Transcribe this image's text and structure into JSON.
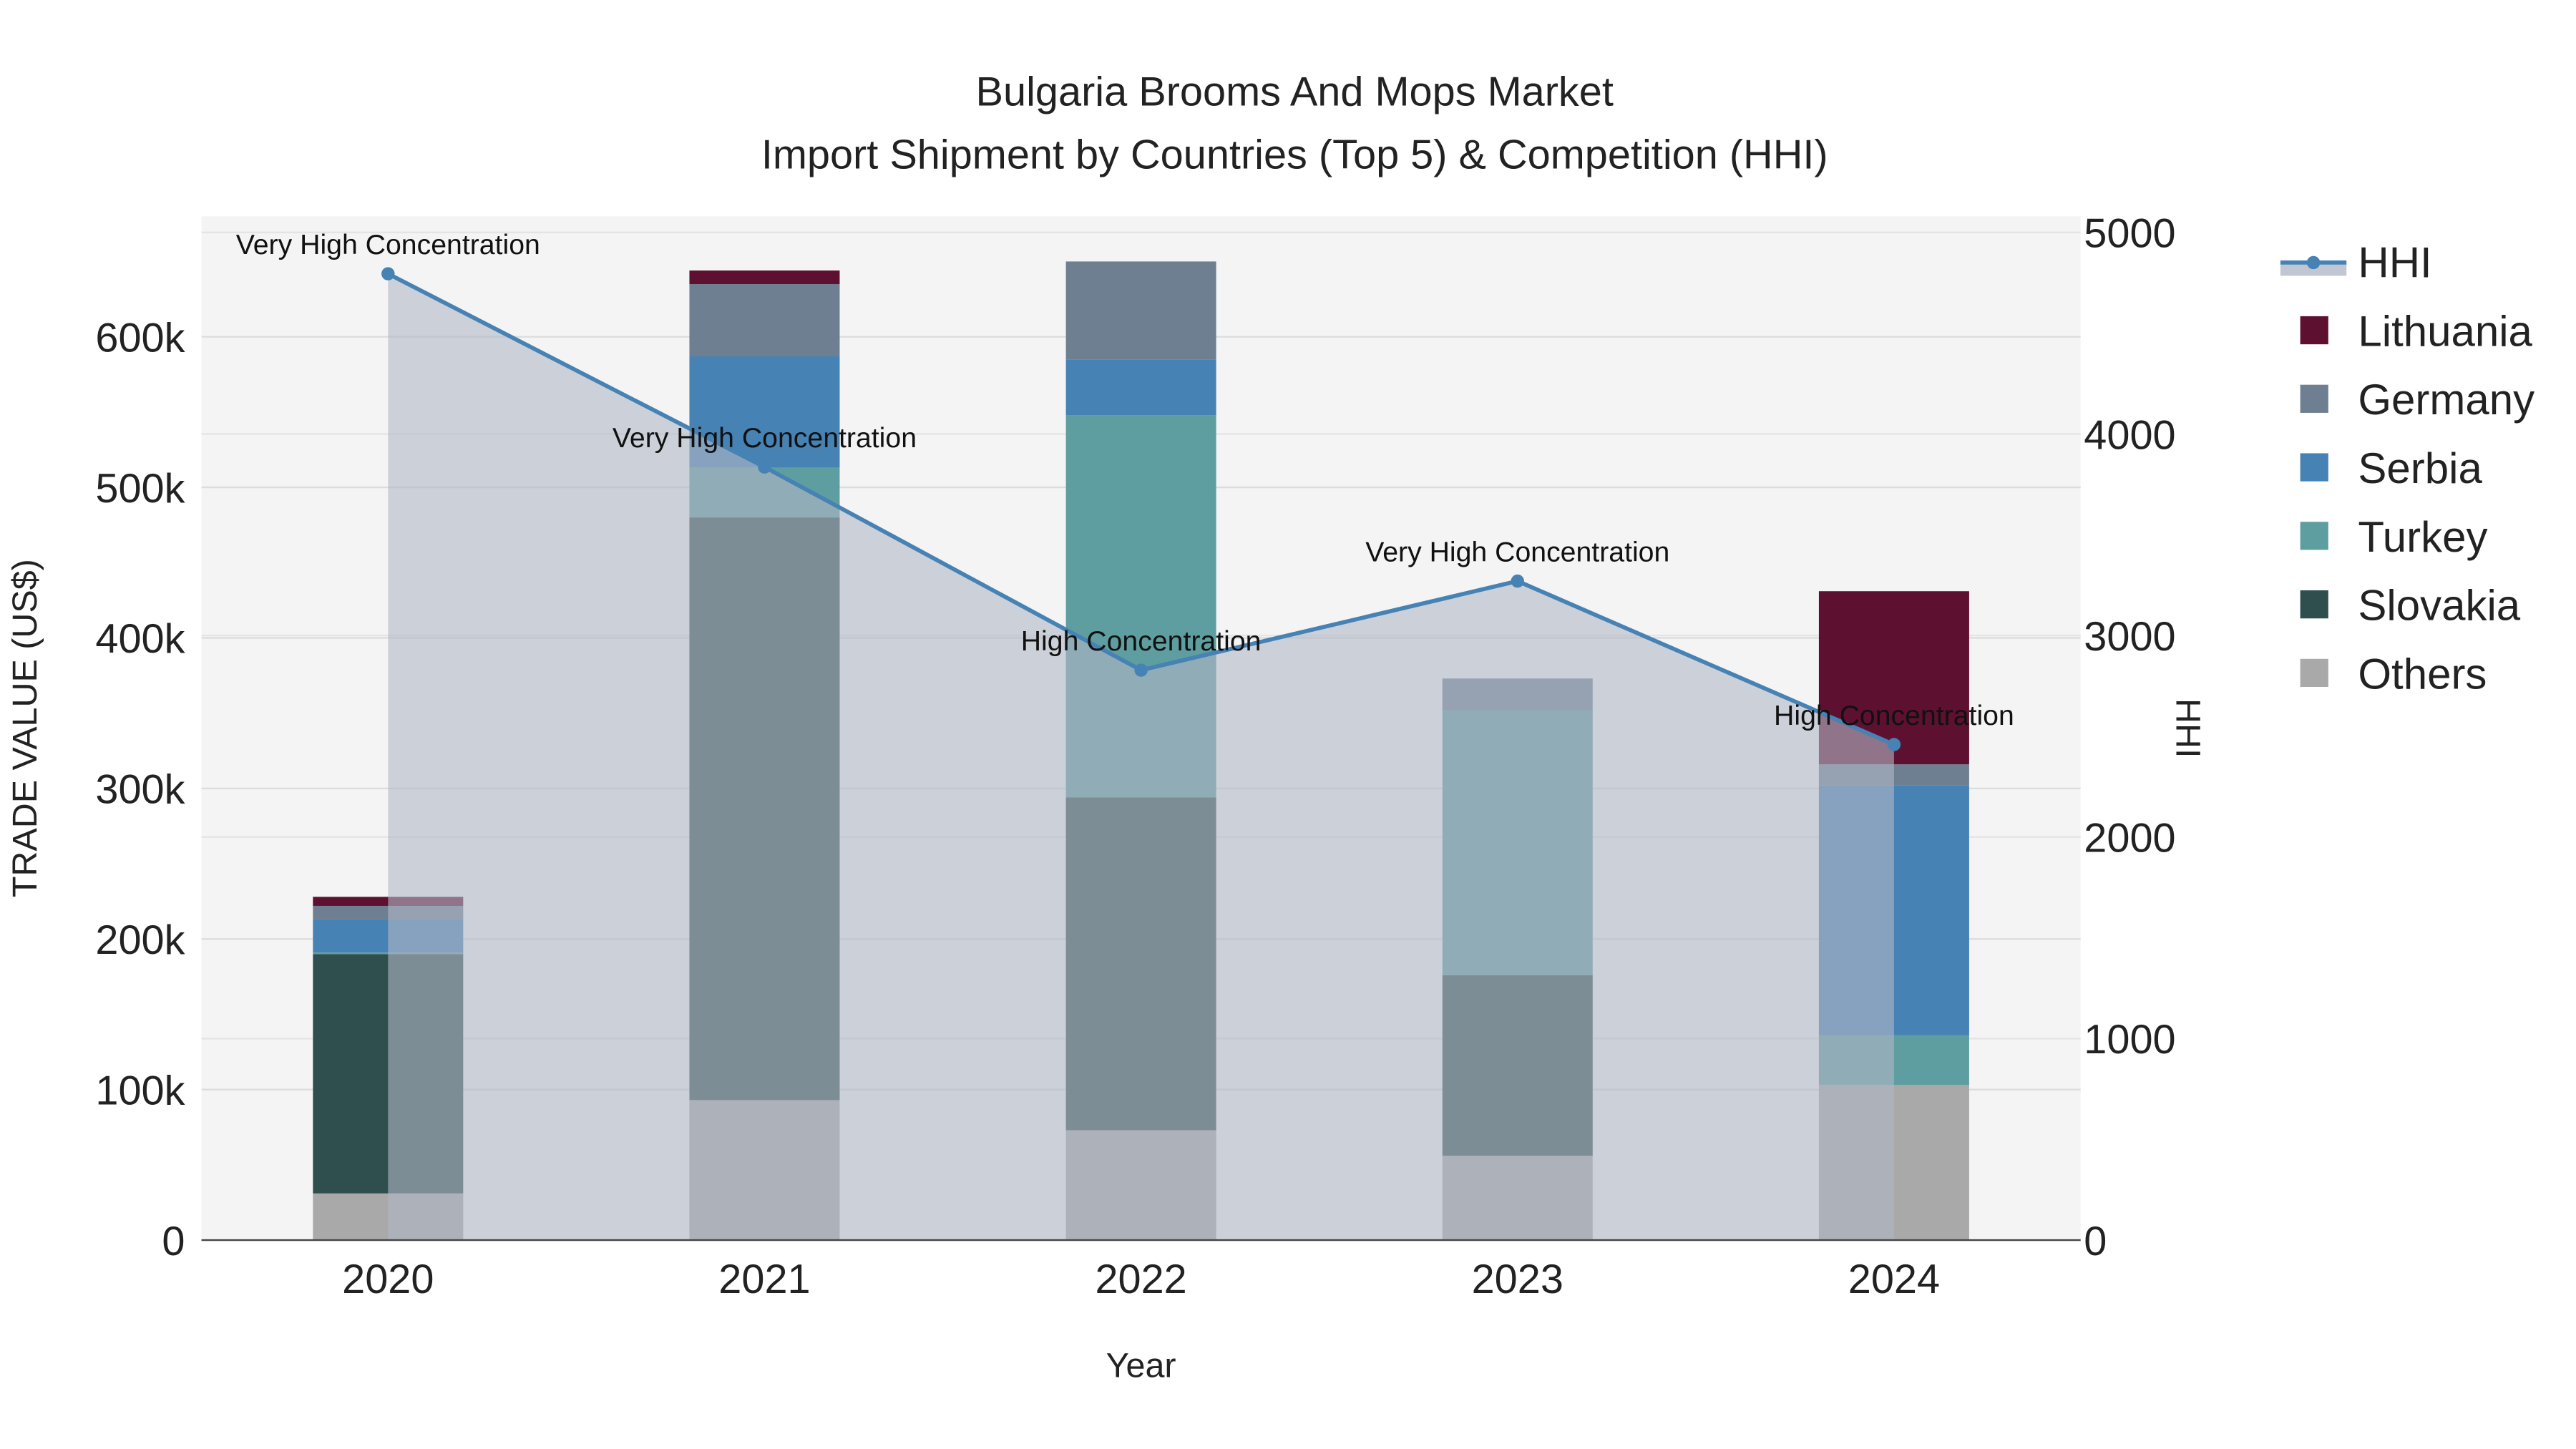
{
  "chart_data": {
    "type": "bar",
    "title": "Bulgaria Brooms And Mops Market",
    "subtitle": "Import Shipment by Countries (Top 5) & Competition (HHI)",
    "xlabel": "Year",
    "ylabel": "TRADE VALUE (US$)",
    "y2label": "HHI",
    "categories": [
      "2020",
      "2021",
      "2022",
      "2023",
      "2024"
    ],
    "ylim": [
      0,
      680000
    ],
    "y2lim": [
      0,
      5080
    ],
    "yticks": [
      0,
      100000,
      200000,
      300000,
      400000,
      500000,
      600000
    ],
    "ytick_labels": [
      "0",
      "100k",
      "200k",
      "300k",
      "400k",
      "500k",
      "600k"
    ],
    "y2ticks": [
      0,
      1000,
      2000,
      3000,
      4000,
      5000
    ],
    "y2tick_labels": [
      "0",
      "1000",
      "2000",
      "3000",
      "4000",
      "5000"
    ],
    "stacked": true,
    "series": [
      {
        "name": "Others",
        "color": "#a9a9a9",
        "values": [
          31000,
          93000,
          73000,
          56000,
          103000
        ]
      },
      {
        "name": "Slovakia",
        "color": "#2f4f4f",
        "values": [
          159000,
          387000,
          221000,
          120000,
          0
        ]
      },
      {
        "name": "Turkey",
        "color": "#5f9ea0",
        "values": [
          1000,
          33000,
          254000,
          176000,
          33000
        ]
      },
      {
        "name": "Serbia",
        "color": "#4682b4",
        "values": [
          22000,
          74000,
          37000,
          0,
          166000
        ]
      },
      {
        "name": "Germany",
        "color": "#6e7f91",
        "values": [
          9000,
          48000,
          65000,
          21000,
          14000
        ]
      },
      {
        "name": "Lithuania",
        "color": "#5e1030",
        "values": [
          6000,
          9000,
          0,
          0,
          115000
        ]
      }
    ],
    "line": {
      "name": "HHI",
      "color": "#4682b4",
      "values": [
        4795,
        3836,
        2828,
        3270,
        2459
      ]
    },
    "annotations": [
      "Very High Concentration",
      "Very High Concentration",
      "High Concentration",
      "Very High Concentration",
      "High Concentration"
    ],
    "legend": [
      "HHI",
      "Lithuania",
      "Germany",
      "Serbia",
      "Turkey",
      "Slovakia",
      "Others"
    ],
    "legend_placement": "right",
    "grid": true
  }
}
